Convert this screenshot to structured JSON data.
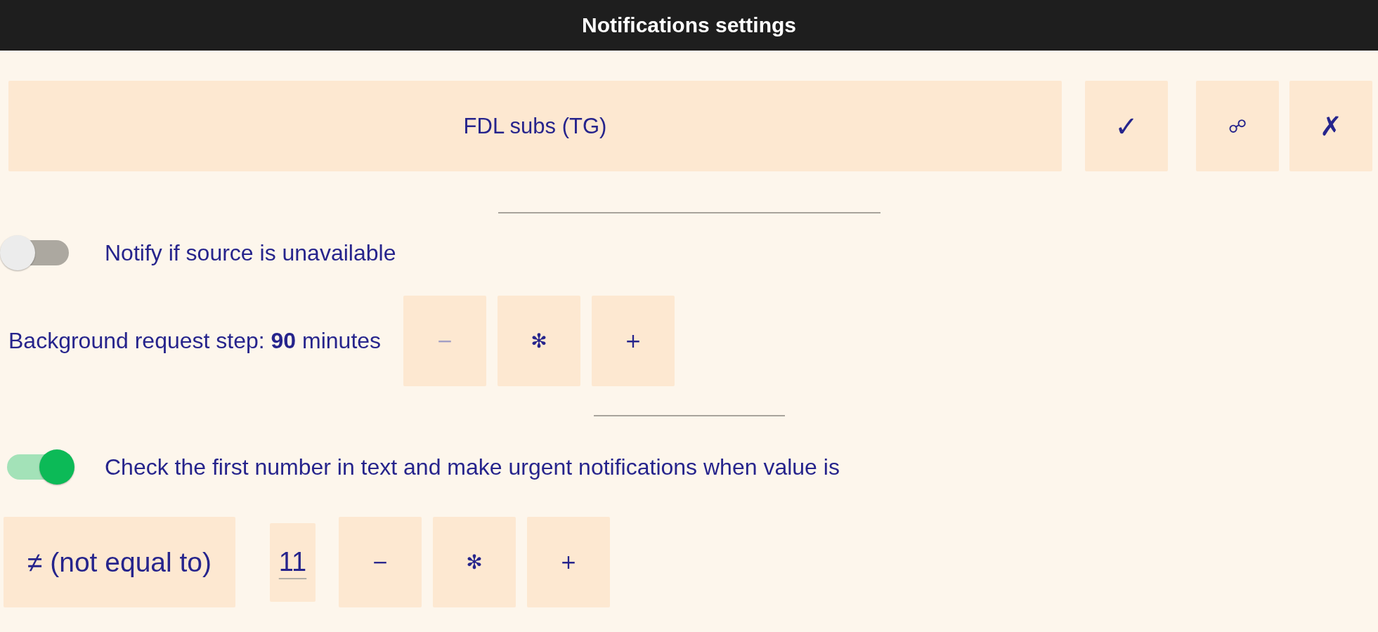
{
  "window": {
    "title": "Notifications settings"
  },
  "source": {
    "name": "FDL subs (TG)",
    "actions": [
      {
        "label": "✓"
      },
      {
        "label": "☍"
      },
      {
        "label": "✗"
      }
    ]
  },
  "availability": {
    "label": "Notify if source is unavailable",
    "on": false
  },
  "request_step": {
    "label": "Background request step: **90** minutes",
    "buttons": [
      {
        "label": "−",
        "disabled": true
      },
      {
        "label": "✻",
        "disabled": false
      },
      {
        "label": "+",
        "disabled": false
      }
    ]
  },
  "urgent": {
    "label": "Check the first number in text and make urgent notifications when value is",
    "on": true,
    "operator": "≠ (not equal to)",
    "value": "11",
    "buttons": [
      {
        "label": "−",
        "disabled": false
      },
      {
        "label": "✻",
        "disabled": false
      },
      {
        "label": "+",
        "disabled": false
      }
    ]
  }
}
